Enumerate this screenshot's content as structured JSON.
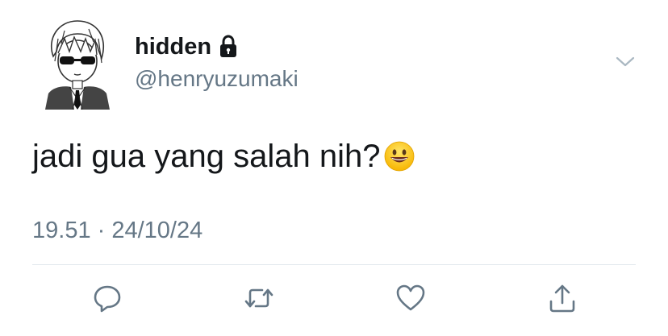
{
  "tweet": {
    "display_name": "hidden",
    "handle": "@henryuzumaki",
    "text": "jadi gua yang salah nih?",
    "timestamp": "19.51 · 24/10/24",
    "emoji": "grinning-face",
    "verified_lock": true
  },
  "icons": {
    "lock": "lock-icon",
    "menu": "chevron-down-icon",
    "reply": "reply-icon",
    "retweet": "retweet-icon",
    "like": "heart-icon",
    "share": "share-icon"
  },
  "colors": {
    "text_primary": "#14171a",
    "text_secondary": "#657786",
    "divider": "#e1e8ed",
    "icon": "#657786"
  }
}
